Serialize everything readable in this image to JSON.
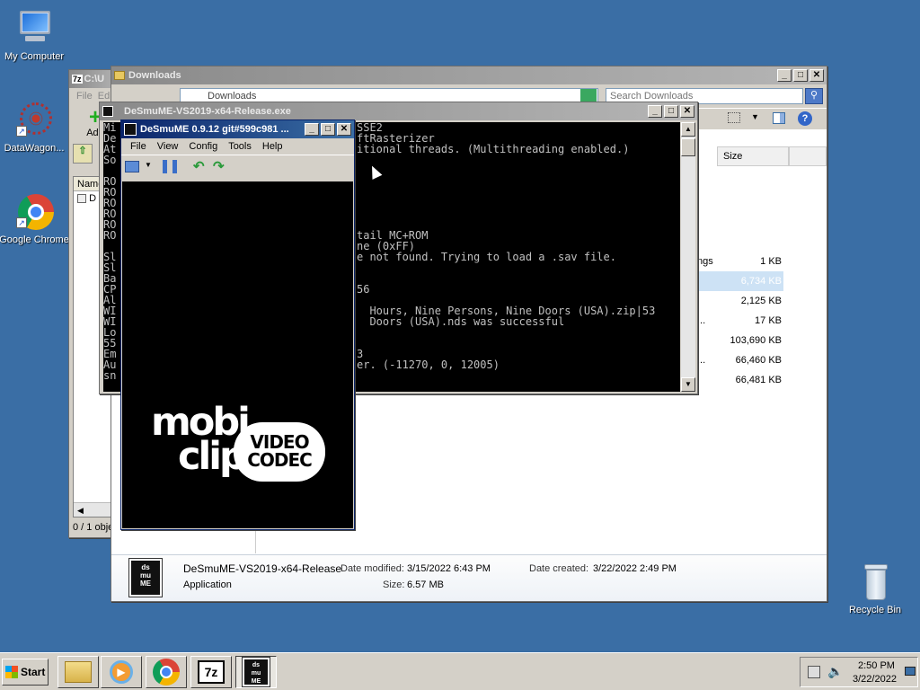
{
  "desktop": {
    "icons": [
      {
        "label": "My Computer"
      },
      {
        "label": "DataWagon..."
      },
      {
        "label": "Google Chrome"
      },
      {
        "label": "Recycle Bin"
      }
    ]
  },
  "sevenzip": {
    "title": "C:\\U",
    "menu": [
      "File",
      "Ed"
    ],
    "add_label": "Add",
    "col_name": "Name",
    "row": "D",
    "status": "0 / 1 obje"
  },
  "explorer": {
    "title": "Downloads",
    "address": "Downloads",
    "search_placeholder": "Search Downloads",
    "col_size": "Size",
    "rows": [
      {
        "name": "ngs",
        "size": "1 KB"
      },
      {
        "name": "",
        "size": "6,734 KB"
      },
      {
        "name": "",
        "size": "2,125 KB"
      },
      {
        "name": "...",
        "size": "17 KB"
      },
      {
        "name": "",
        "size": "103,690 KB"
      },
      {
        "name": "...",
        "size": "66,460 KB"
      },
      {
        "name": "",
        "size": "66,481 KB"
      }
    ],
    "details": {
      "name": "DeSmuME-VS2019-x64-Release",
      "type": "Application",
      "modified_label": "Date modified:",
      "modified_value": "3/15/2022 6:43 PM",
      "created_label": "Date created:",
      "created_value": "3/22/2022 2:49 PM",
      "size_label": "Size:",
      "size_value": "6.57 MB"
    }
  },
  "console": {
    "title": "DeSmuME-VS2019-x64-Release.exe",
    "left_col": [
      "Mi",
      "De",
      "At",
      "So",
      "",
      "RO",
      "RO",
      "RO",
      "RO",
      "RO",
      "RO",
      "",
      "Sl",
      "Sl",
      "Ba",
      "CP",
      "Al",
      "WI",
      "WI",
      "Lo",
      "55",
      "Em",
      "Au",
      "sn"
    ],
    "lines": [
      "SSE2",
      "ftRasterizer",
      "itional threads. (Multithreading enabled.)",
      "",
      "",
      "",
      "",
      "",
      "",
      "",
      "tail MC+ROM",
      "ne (0xFF)",
      "e not found. Trying to load a .sav file.",
      "",
      "",
      "56",
      "",
      "  Hours, Nine Persons, Nine Doors (USA).zip|53",
      "  Doors (USA).nds was successful",
      "",
      "",
      "3",
      "er. (-11270, 0, 12005)"
    ]
  },
  "desmume": {
    "title": "DeSmuME 0.9.12 git#599c981 ...",
    "menu": [
      "File",
      "View",
      "Config",
      "Tools",
      "Help"
    ],
    "logo_line1": "mobi",
    "logo_line2": "clip",
    "badge_line1": "VIDEO",
    "badge_line2": "CODEC"
  },
  "taskbar": {
    "start": "Start",
    "clock_time": "2:50 PM",
    "clock_date": "3/22/2022",
    "sevenzip_label": "7z"
  },
  "colors": {
    "desktop": "#3a6ea5",
    "title_active": "#0a246a",
    "console_bg": "#000000"
  }
}
